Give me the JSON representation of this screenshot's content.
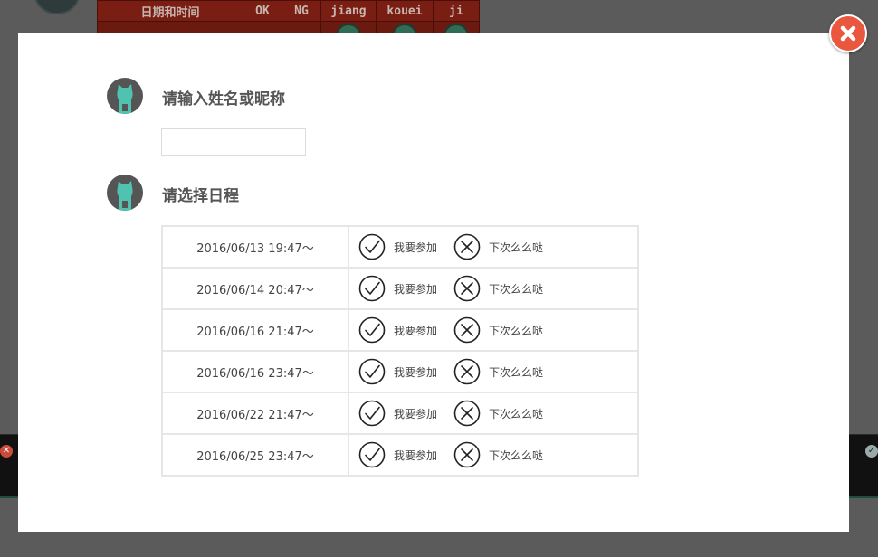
{
  "background": {
    "table_headers": [
      "日期和时间",
      "OK",
      "NG",
      "jiang",
      "kouei",
      "ji"
    ]
  },
  "modal": {
    "close_icon": "close-x-icon",
    "accent_color": "#e9573f",
    "avatar_color": "#4fc3b0",
    "step1": {
      "title": "请输入姓名或昵称",
      "input_value": "",
      "input_placeholder": ""
    },
    "step2": {
      "title": "请选择日程",
      "rows": [
        {
          "date": "2016/06/13 19:47〜",
          "yes_label": "我要参加",
          "no_label": "下次么么哒"
        },
        {
          "date": "2016/06/14 20:47〜",
          "yes_label": "我要参加",
          "no_label": "下次么么哒"
        },
        {
          "date": "2016/06/16 21:47〜",
          "yes_label": "我要参加",
          "no_label": "下次么么哒"
        },
        {
          "date": "2016/06/16 23:47〜",
          "yes_label": "我要参加",
          "no_label": "下次么么哒"
        },
        {
          "date": "2016/06/22 21:47〜",
          "yes_label": "我要参加",
          "no_label": "下次么么哒"
        },
        {
          "date": "2016/06/25 23:47〜",
          "yes_label": "我要参加",
          "no_label": "下次么么哒"
        }
      ]
    }
  }
}
